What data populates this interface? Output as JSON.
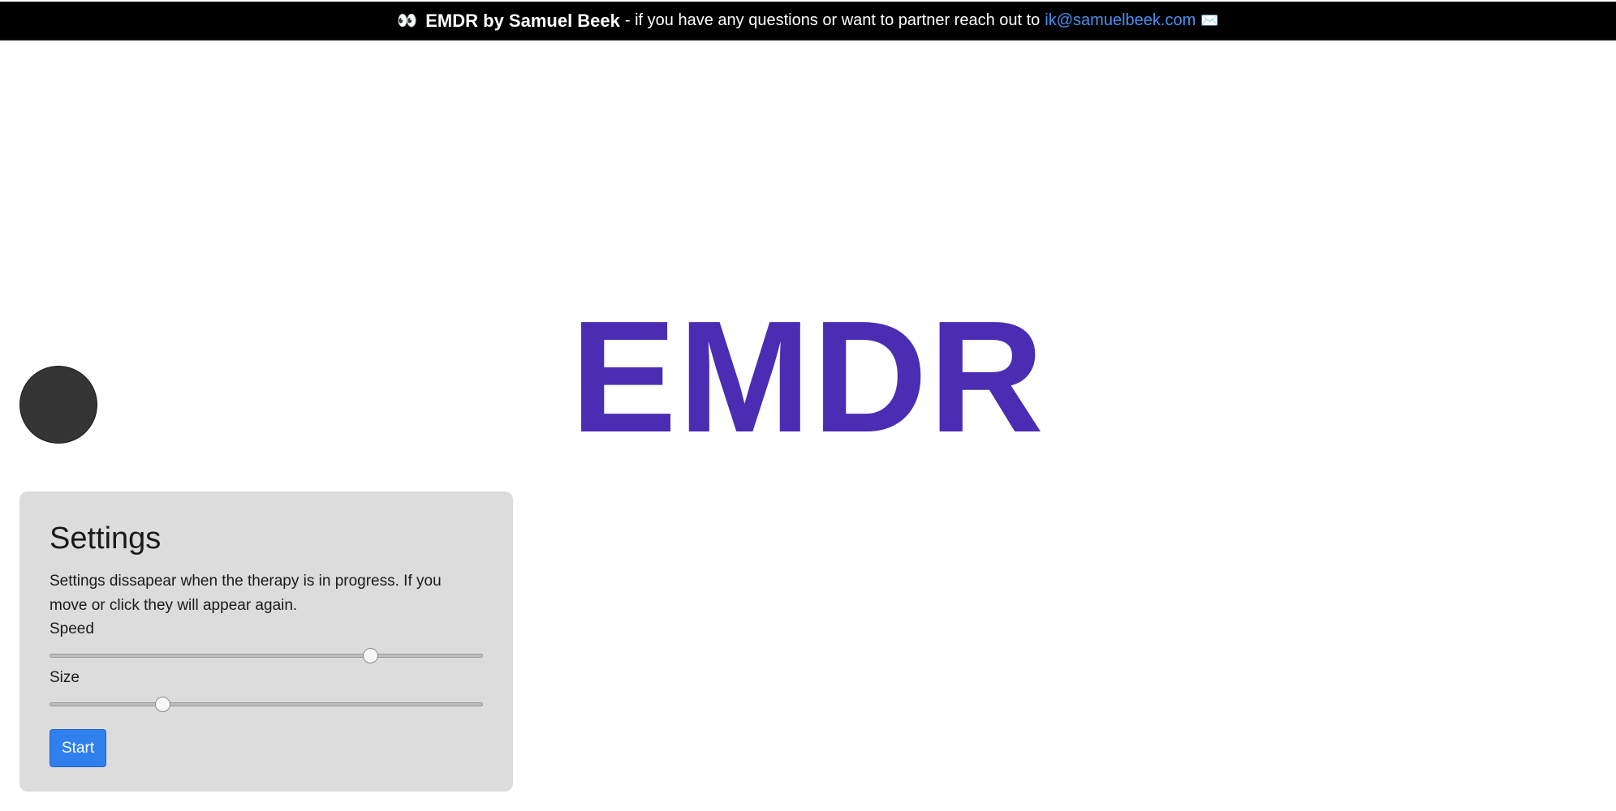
{
  "header": {
    "eyes_icon": "eyes-emoji",
    "eyes_glyph": "👀",
    "brand": "EMDR by Samuel Beek",
    "tagline": "- if you have any questions or want to partner reach out to",
    "email": "ik@samuelbeek.com",
    "mail_icon": "envelope-icon",
    "mail_glyph": "✉️",
    "link_color": "#4a90f0"
  },
  "hero": {
    "title": "EMDR",
    "color": "#4a2db3"
  },
  "ball": {
    "color": "#353535"
  },
  "settings": {
    "title": "Settings",
    "description": "Settings dissapear when the therapy is in progress. If you move or click they will appear again.",
    "speed_label": "Speed",
    "speed_value": 0.74,
    "size_label": "Size",
    "size_value": 0.26,
    "start_label": "Start",
    "start_color": "#2f80ed"
  }
}
